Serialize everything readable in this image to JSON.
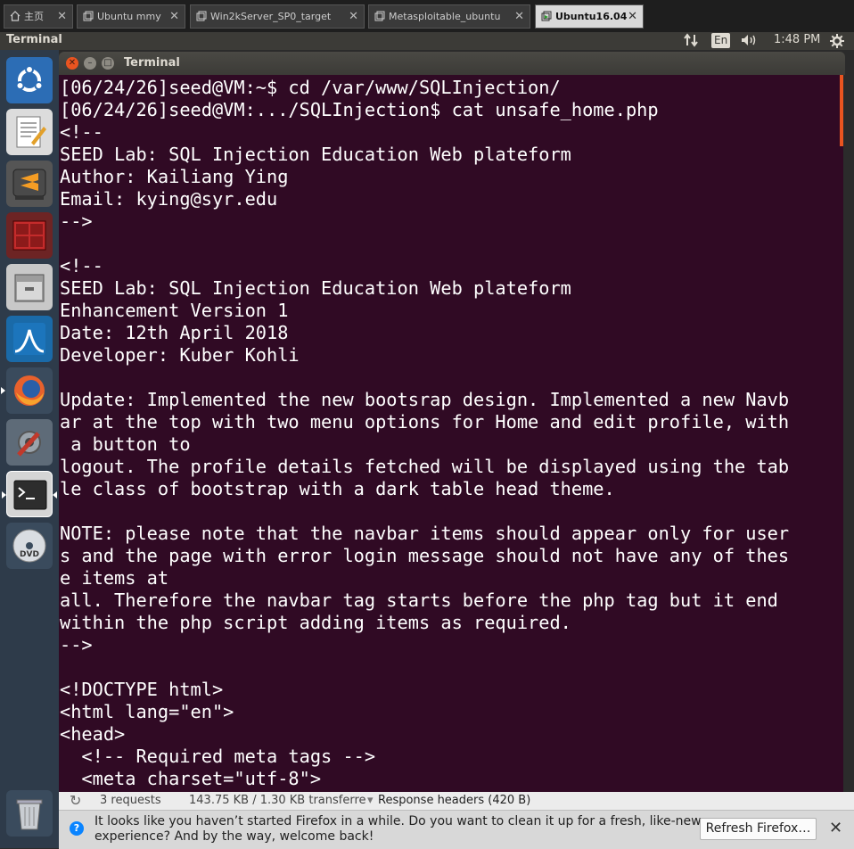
{
  "vm_tabs": [
    {
      "label": "主页",
      "icon": "home-icon"
    },
    {
      "label": "Ubuntu mmy",
      "icon": "vm-icon"
    },
    {
      "label": "Win2kServer_SP0_target",
      "icon": "vm-icon"
    },
    {
      "label": "Metasploitable_ubuntu",
      "icon": "vm-icon"
    },
    {
      "label": "Ubuntu16.04",
      "icon": "vm-running-icon"
    }
  ],
  "panel": {
    "app_title": "Terminal",
    "keyboard": "En",
    "time": "1:48 PM"
  },
  "launcher": [
    "ubuntu-dash-icon",
    "text-editor-icon",
    "sublime-text-icon",
    "terminal-multiplexer-icon",
    "file-manager-icon",
    "wireshark-icon",
    "firefox-icon",
    "system-settings-icon",
    "terminal-icon",
    "dvd-icon",
    "trash-icon"
  ],
  "terminal": {
    "title": "Terminal",
    "output": "[06/24/26]seed@VM:~$ cd /var/www/SQLInjection/\n[06/24/26]seed@VM:.../SQLInjection$ cat unsafe_home.php\n<!--\nSEED Lab: SQL Injection Education Web plateform\nAuthor: Kailiang Ying\nEmail: kying@syr.edu\n-->\n\n<!--\nSEED Lab: SQL Injection Education Web plateform\nEnhancement Version 1\nDate: 12th April 2018\nDeveloper: Kuber Kohli\n\nUpdate: Implemented the new bootsrap design. Implemented a new Navb\nar at the top with two menu options for Home and edit profile, with\n a button to\nlogout. The profile details fetched will be displayed using the tab\nle class of bootstrap with a dark table head theme.\n\nNOTE: please note that the navbar items should appear only for user\ns and the page with error login message should not have any of thes\ne items at\nall. Therefore the navbar tag starts before the php tag but it end\nwithin the php script adding items as required.\n-->\n\n<!DOCTYPE html>\n<html lang=\"en\">\n<head>\n  <!-- Required meta tags -->\n  <meta charset=\"utf-8\">"
  },
  "firefox": {
    "requests": "3 requests",
    "transferred": "143.75 KB / 1.30 KB transferre",
    "response_headers": "Response headers (420 B)",
    "notification": "It looks like you haven’t started Firefox in a while. Do you want to clean it up for a fresh, like-new experience? And by the way, welcome back!",
    "refresh_button": "Refresh Firefox…",
    "close": "✕"
  },
  "colors": {
    "terminal_bg": "#300a24",
    "launcher_bg": "#2e3b4a",
    "panel_bg": "#3c3b37",
    "accent_orange": "#e95420"
  }
}
